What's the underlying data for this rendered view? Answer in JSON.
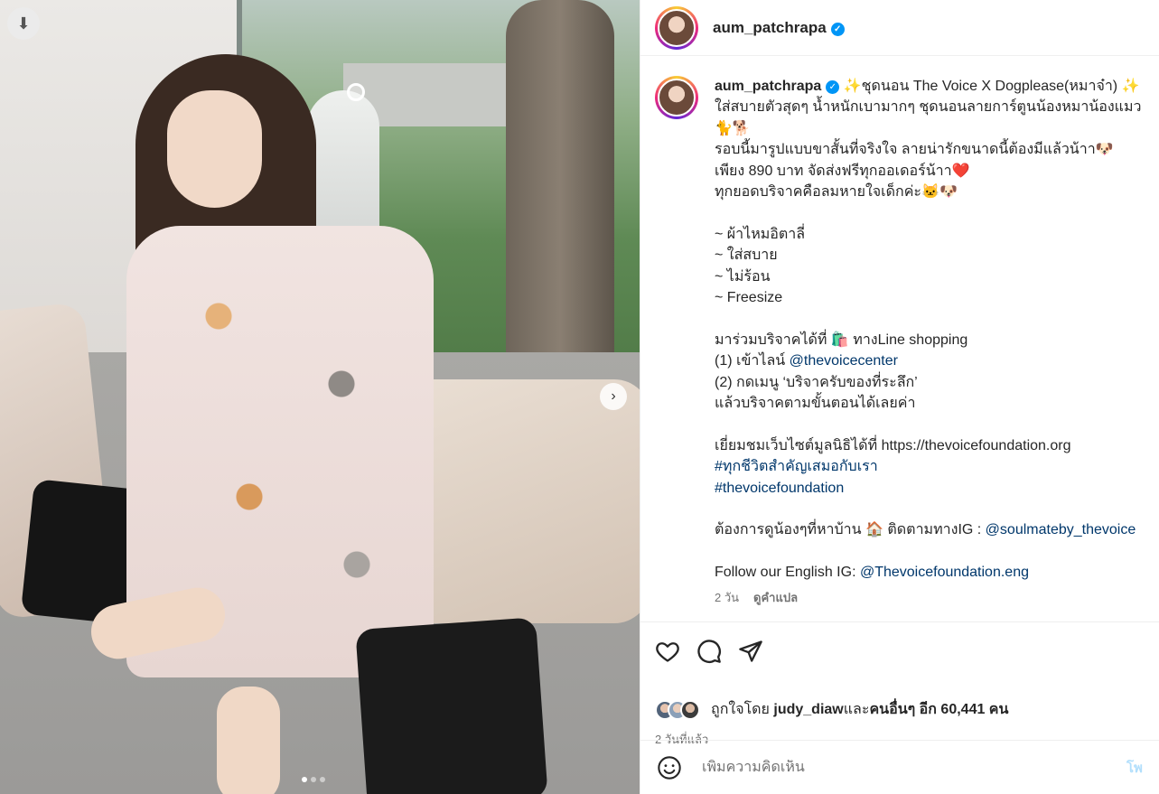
{
  "post": {
    "username": "aum_patchrapa",
    "caption_lines": [
      "✨ชุดนอน The Voice X Dogplease(หมาจ๋า) ✨",
      "ใส่สบายตัวสุดๆ น้ำหนักเบามากๆ ชุดนอนลายการ์ตูนน้องหมาน้องแมว",
      "🐈🐕",
      "รอบนี้มารูปแบบขาสั้นที่จริงใจ ลายน่ารักขนาดนี้ต้องมีแล้วน้าา🐶",
      "เพียง 890 บาท จัดส่งฟรีทุกออเดอร์น้าา❤️",
      "ทุกยอดบริจาคคือลมหายใจเด็กค่ะ🐱🐶",
      "",
      "~ ผ้าไหมอิตาลี่",
      "~ ใส่สบาย",
      "~ ไม่ร้อน",
      "~ Freesize",
      "",
      "มาร่วมบริจาคได้ที่ 🛍️ ทางLine shopping",
      "(1) เข้าไลน์ ",
      "(2) กดเมนู ‘บริจาครับของที่ระลึก’",
      "แล้วบริจาคตามขั้นตอนได้เลยค่า",
      "",
      "เยี่ยมชมเว็บไซต์มูลนิธิได้ที่ https://thevoicefoundation.org",
      "",
      "",
      "",
      "ต้องการดูน้องๆที่หาบ้าน 🏠 ติดตามทางIG : ",
      "",
      "Follow our English IG: "
    ],
    "mention_voicecenter": "@thevoicecenter",
    "hashtag_1": "#ทุกชีวิตสำคัญเสมอกับเรา",
    "hashtag_2": "#thevoicefoundation",
    "mention_soulmate": "@soulmateby_thevoice",
    "mention_eng": "@Thevoicefoundation.eng",
    "caption_age": "2 วัน",
    "see_translation": "ดูคำแปล",
    "likes_prefix": "ถูกใจโดย ",
    "likes_user": "judy_diaw",
    "likes_middle": " และ",
    "likes_others": "คนอื่นๆ อีก 60,441 คน",
    "time_ago": "2 วันที่แล้ว",
    "comment_placeholder": "เพิ่มความคิดเห็น",
    "post_button": "โพ",
    "carousel": {
      "count": 3,
      "active_index": 0
    }
  },
  "icons": [
    "download-icon",
    "tag-icon",
    "chevron-right-icon",
    "verified-badge-icon",
    "heart-icon",
    "comment-icon",
    "share-icon",
    "emoji-icon"
  ],
  "colors": {
    "link": "#00376b",
    "verified": "#0095f6",
    "muted": "#737373"
  }
}
